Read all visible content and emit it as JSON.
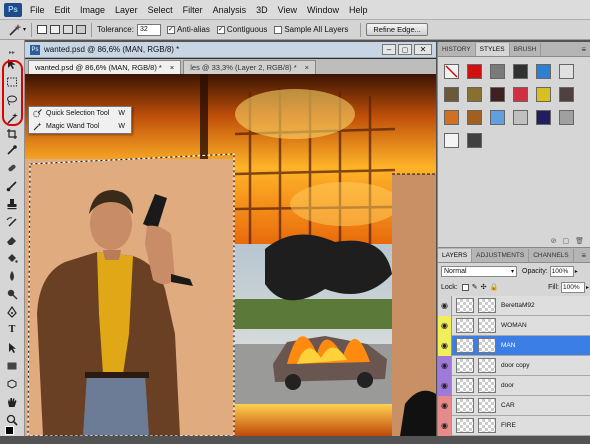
{
  "app": {
    "logo": "Ps"
  },
  "menu": [
    "File",
    "Edit",
    "Image",
    "Layer",
    "Select",
    "Filter",
    "Analysis",
    "3D",
    "View",
    "Window",
    "Help"
  ],
  "options": {
    "tolerance_label": "Tolerance:",
    "tolerance_value": "32",
    "antialias_label": "Anti-alias",
    "antialias_checked": true,
    "contiguous_label": "Contiguous",
    "contiguous_checked": true,
    "sample_all_label": "Sample All Layers",
    "sample_all_checked": false,
    "refine_label": "Refine Edge..."
  },
  "document": {
    "window_title": "wanted.psd @ 86,6% (MAN, RGB/8) *",
    "tabs": [
      {
        "label": "wanted.psd @ 86,6% (MAN, RGB/8) *",
        "active": true
      },
      {
        "label": "les @ 33,3% (Layer 2, RGB/8) *",
        "active": false
      }
    ]
  },
  "flyout": {
    "items": [
      {
        "label": "Quick Selection Tool",
        "key": "W"
      },
      {
        "label": "Magic Wand Tool",
        "key": "W"
      }
    ]
  },
  "panels_top": {
    "tabs": [
      "HISTORY",
      "STYLES",
      "BRUSH"
    ],
    "active": "STYLES"
  },
  "styles_swatches": [
    "#f2f2f2",
    "#d01010",
    "#7a7a7a",
    "#303030",
    "#2f7fd0",
    "#e0e0e0",
    "#6a5a3a",
    "#8a7030",
    "#402020",
    "#d03040",
    "#d8c020",
    "#504040",
    "#d07020",
    "#a06020",
    "#60a0e0",
    "#c0c0c0",
    "#202060",
    "#a0a0a0",
    "#f4f4f4",
    "#404040"
  ],
  "panels_bottom": {
    "tabs": [
      "LAYERS",
      "ADJUSTMENTS",
      "CHANNELS"
    ],
    "active": "LAYERS"
  },
  "layers_panel": {
    "blend_mode": "Normal",
    "opacity_label": "Opacity:",
    "opacity_value": "100%",
    "lock_label": "Lock:",
    "fill_label": "Fill:",
    "fill_value": "100%"
  },
  "layers": [
    {
      "name": "BerettaM92",
      "color": "#d6d6d6",
      "selected": false
    },
    {
      "name": "WOMAN",
      "color": "#f2ee5a",
      "selected": false
    },
    {
      "name": "MAN",
      "color": "#f2ee5a",
      "selected": true
    },
    {
      "name": "door copy",
      "color": "#a07ad8",
      "selected": false
    },
    {
      "name": "door",
      "color": "#a07ad8",
      "selected": false
    },
    {
      "name": "CAR",
      "color": "#e78a8a",
      "selected": false
    },
    {
      "name": "FIRE",
      "color": "#e78a8a",
      "selected": false
    }
  ]
}
